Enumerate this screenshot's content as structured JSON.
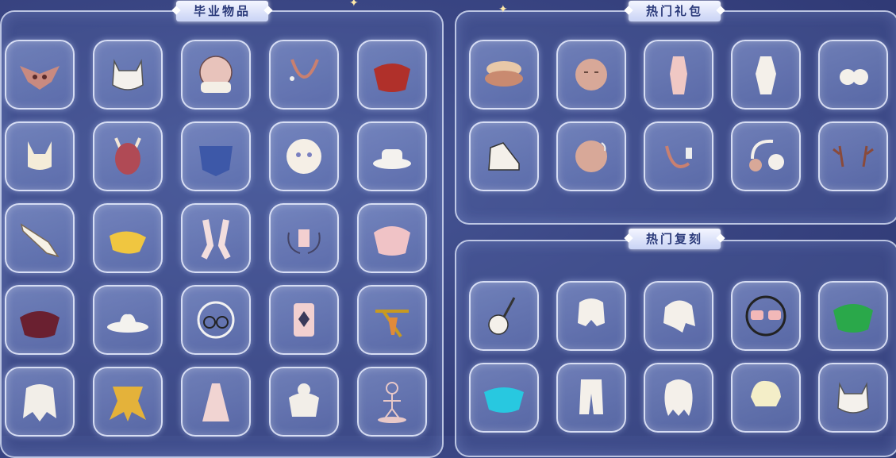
{
  "sections": {
    "graduation": {
      "title": "毕业物品",
      "items": [
        "bird-mask-icon",
        "cat-ear-hair-icon",
        "round-mask-icon",
        "bead-necklace-icon",
        "red-cape-icon",
        "fox-ear-hair-icon",
        "deer-mask-icon",
        "blue-cape-icon",
        "owl-mask-icon",
        "white-hat-icon",
        "horn-instrument-icon",
        "yellow-cape-icon",
        "pink-scarf-icon",
        "swirl-ornament-icon",
        "flower-cape-icon",
        "dark-red-cape-icon",
        "cowboy-hat-icon",
        "round-glasses-icon",
        "pink-pendant-icon",
        "gold-sword-charm-icon",
        "white-long-hair-icon",
        "gold-bow-cape-icon",
        "pink-dress-icon",
        "bun-hair-icon",
        "figure-statue-icon"
      ]
    },
    "hot_pack": {
      "title": "热门礼包",
      "items": [
        "layered-hat-icon",
        "plain-mask-icon",
        "pink-outfit-icon",
        "white-outfit-icon",
        "ear-muff-icon",
        "white-shoe-icon",
        "moon-mask-icon",
        "pink-necklace-icon",
        "headphones-icon",
        "antlers-icon"
      ]
    },
    "hot_rerun": {
      "title": "热门复刻",
      "items": [
        "guitar-icon",
        "twin-tail-hair-icon",
        "ponytail-hair-icon",
        "sunglasses-icon",
        "green-cape-icon",
        "cyan-cape-icon",
        "white-pants-icon",
        "wavy-hair-icon",
        "short-hair-icon",
        "cat-ear-hair-icon"
      ]
    }
  }
}
